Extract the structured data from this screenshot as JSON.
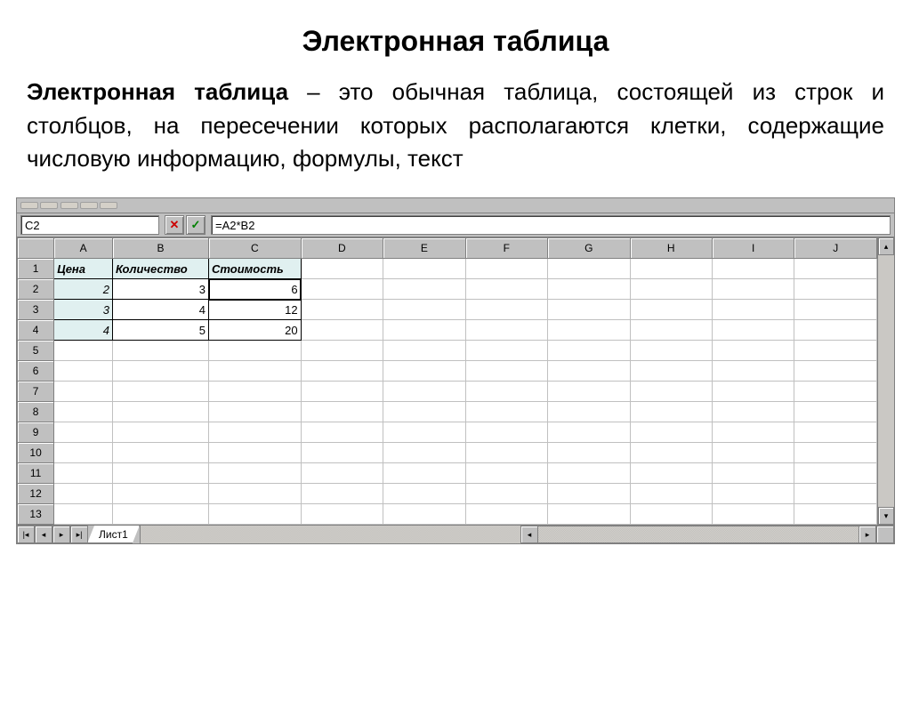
{
  "title": "Электронная таблица",
  "description_bold": "Электронная таблица",
  "description_rest": " – это обычная таблица, состоящей из строк и столбцов, на пересечении которых располагаются клетки, содержащие числовую информацию, формулы, текст",
  "spreadsheet": {
    "name_box": "C2",
    "cancel_symbol": "✕",
    "accept_symbol": "✓",
    "formula": "=A2*B2",
    "columns": [
      "A",
      "B",
      "C",
      "D",
      "E",
      "F",
      "G",
      "H",
      "I",
      "J"
    ],
    "rows": [
      "1",
      "2",
      "3",
      "4",
      "5",
      "6",
      "7",
      "8",
      "9",
      "10",
      "11",
      "12",
      "13"
    ],
    "headers": {
      "A": "Цена",
      "B": "Количество",
      "C": "Стоимость"
    },
    "data": [
      {
        "A": "2",
        "B": "3",
        "C": "6"
      },
      {
        "A": "3",
        "B": "4",
        "C": "12"
      },
      {
        "A": "4",
        "B": "5",
        "C": "20"
      }
    ],
    "sheet_tab": "Лист1",
    "nav": {
      "first": "|◂",
      "prev": "◂",
      "next": "▸",
      "last": "▸|",
      "up": "▴",
      "down": "▾",
      "left": "◂",
      "right": "▸"
    }
  }
}
